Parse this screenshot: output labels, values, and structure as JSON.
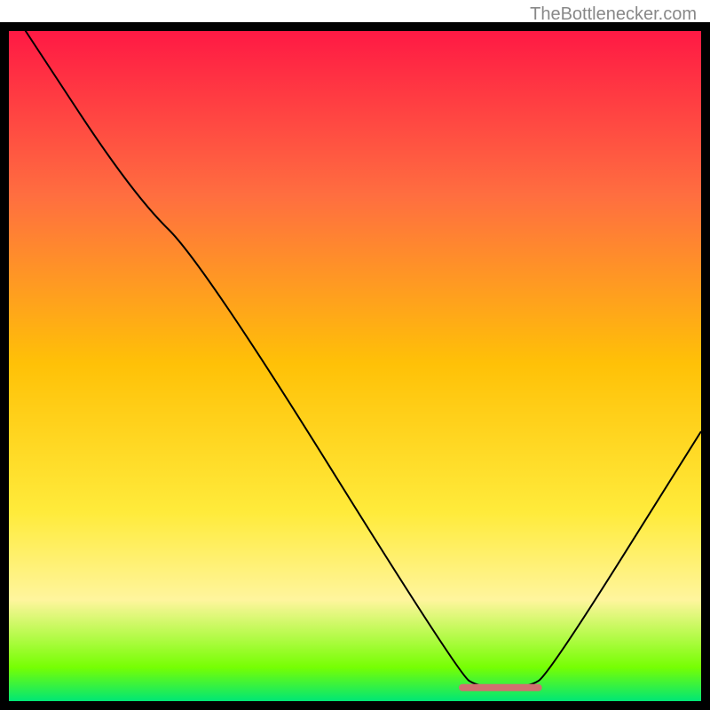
{
  "watermark": "TheBottlenecker.com",
  "chart_data": {
    "type": "line",
    "title": "",
    "xlabel": "",
    "ylabel": "",
    "xlim": [
      0,
      100
    ],
    "ylim": [
      0,
      100
    ],
    "background": {
      "type": "vertical_gradient",
      "stops": [
        {
          "offset": 0,
          "color": "#ff1744"
        },
        {
          "offset": 25,
          "color": "#ff6e40"
        },
        {
          "offset": 50,
          "color": "#ffc107"
        },
        {
          "offset": 72,
          "color": "#ffeb3b"
        },
        {
          "offset": 85,
          "color": "#fff59d"
        },
        {
          "offset": 95,
          "color": "#76ff03"
        },
        {
          "offset": 100,
          "color": "#00e676"
        }
      ]
    },
    "series": [
      {
        "name": "bottleneck-curve",
        "color": "#000000",
        "width": 2,
        "points": [
          {
            "x": 2,
            "y": 100
          },
          {
            "x": 18,
            "y": 75
          },
          {
            "x": 28,
            "y": 65
          },
          {
            "x": 65,
            "y": 4
          },
          {
            "x": 68,
            "y": 2
          },
          {
            "x": 75,
            "y": 2
          },
          {
            "x": 78,
            "y": 4
          },
          {
            "x": 100,
            "y": 40
          }
        ]
      }
    ],
    "marker": {
      "x_start": 65,
      "x_end": 77,
      "y": 2,
      "color": "#d07070"
    },
    "frame": {
      "color": "#000000",
      "width": 10
    }
  }
}
